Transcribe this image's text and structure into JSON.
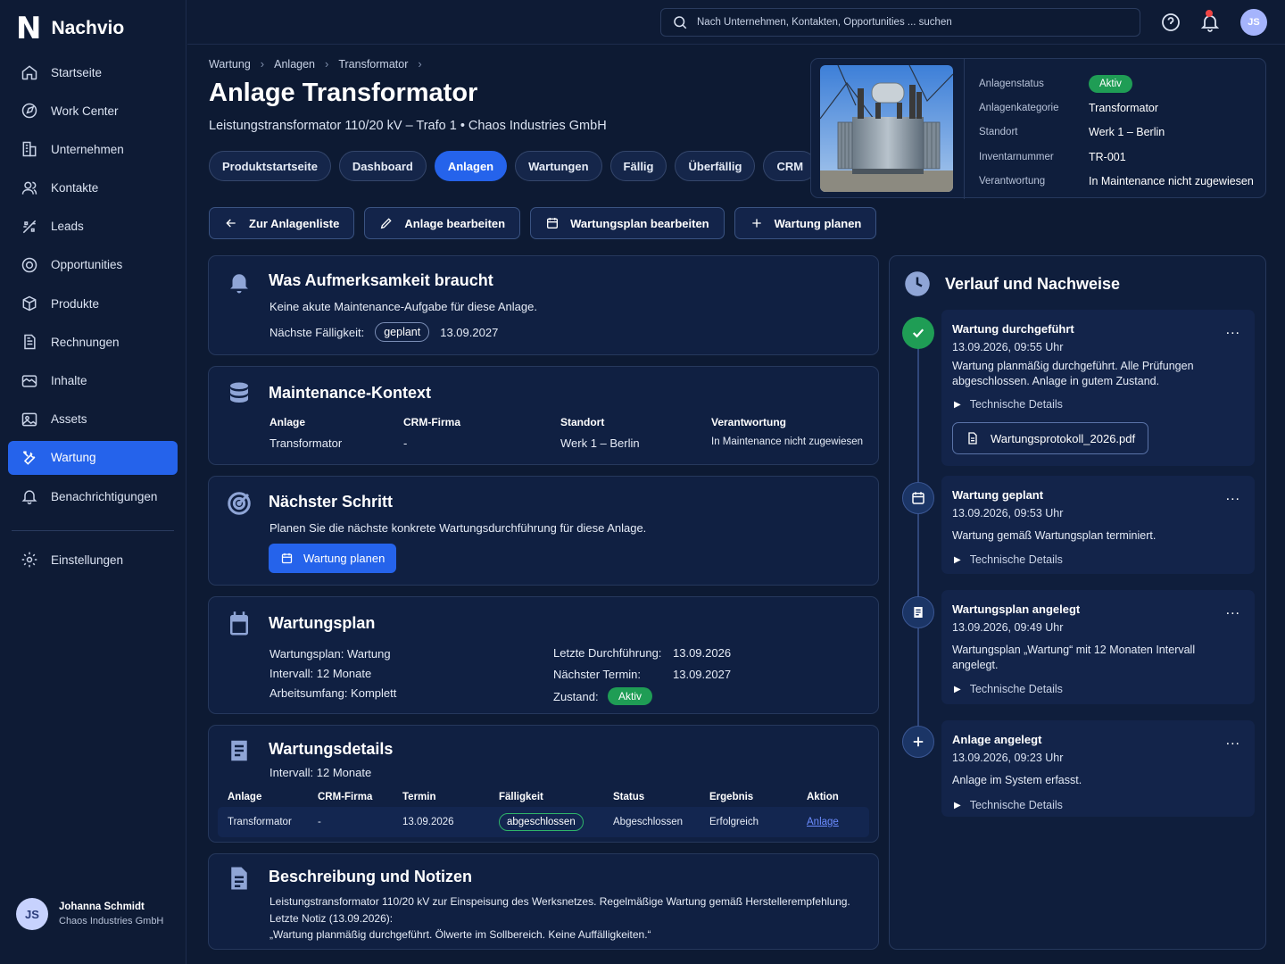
{
  "app": {
    "logo_mark": "N",
    "name": "Nachvio"
  },
  "sidebar": {
    "items": [
      {
        "label": "Startseite",
        "icon": "home-icon"
      },
      {
        "label": "Work Center",
        "icon": "compass-icon"
      },
      {
        "label": "Unternehmen",
        "icon": "building-icon"
      },
      {
        "label": "Kontakte",
        "icon": "users-icon"
      },
      {
        "label": "Leads",
        "icon": "leads-icon"
      },
      {
        "label": "Opportunities",
        "icon": "target-icon"
      },
      {
        "label": "Produkte",
        "icon": "box-icon"
      },
      {
        "label": "Rechnungen",
        "icon": "invoice-icon"
      },
      {
        "label": "Inhalte",
        "icon": "content-icon"
      },
      {
        "label": "Assets",
        "icon": "image-icon"
      },
      {
        "label": "Wartung",
        "icon": "tools-icon",
        "active": true
      },
      {
        "label": "Benachrichtigungen",
        "icon": "bell-icon"
      }
    ],
    "settings_label": "Einstellungen",
    "user": {
      "initials": "JS",
      "name": "Johanna Schmidt",
      "company": "Chaos Industries GmbH"
    }
  },
  "topbar": {
    "search_placeholder": "Nach Unternehmen, Kontakten, Opportunities ... suchen",
    "avatar_initials": "JS"
  },
  "breadcrumb": [
    "Wartung",
    "Anlagen",
    "Transformator"
  ],
  "page": {
    "title": "Anlage Transformator",
    "subtitle": "Leistungstransformator 110/20 kV – Trafo 1  •  Chaos Industries GmbH"
  },
  "tabs": [
    {
      "label": "Produktstartseite"
    },
    {
      "label": "Dashboard"
    },
    {
      "label": "Anlagen",
      "active": true
    },
    {
      "label": "Wartungen"
    },
    {
      "label": "Fällig"
    },
    {
      "label": "Überfällig"
    },
    {
      "label": "CRM"
    }
  ],
  "actions": {
    "back": "Zur Anlagenliste",
    "edit": "Anlage bearbeiten",
    "edit_plan": "Wartungsplan bearbeiten",
    "plan": "Wartung planen"
  },
  "asset": {
    "rows": [
      {
        "label": "Anlagenstatus",
        "value": "Aktiv",
        "badge": true
      },
      {
        "label": "Anlagenkategorie",
        "value": "Transformator"
      },
      {
        "label": "Standort",
        "value": "Werk 1 – Berlin"
      },
      {
        "label": "Inventarnummer",
        "value": "TR-001"
      },
      {
        "label": "Verantwortung",
        "value": "In Maintenance nicht zugewiesen"
      }
    ]
  },
  "attention": {
    "title": "Was Aufmerksamkeit braucht",
    "text": "Keine akute Maintenance-Aufgabe für diese Anlage.",
    "due_label": "Nächste Fälligkeit:",
    "due_tag": "geplant",
    "due_date": "13.09.2027"
  },
  "context": {
    "title": "Maintenance-Kontext",
    "cols": [
      {
        "label": "Anlage",
        "value": "Transformator"
      },
      {
        "label": "CRM-Firma",
        "value": "-"
      },
      {
        "label": "Standort",
        "value": "Werk 1 – Berlin"
      },
      {
        "label": "Verantwortung",
        "value": "In Maintenance nicht zugewiesen"
      }
    ]
  },
  "next_step": {
    "title": "Nächster Schritt",
    "text": "Planen Sie die nächste konkrete Wartungsdurchführung für diese Anlage.",
    "button": "Wartung planen"
  },
  "plan": {
    "title": "Wartungsplan",
    "left": [
      "Wartungsplan: Wartung",
      "Intervall: 12 Monate",
      "Arbeitsumfang: Komplett"
    ],
    "last_label": "Letzte Durchführung:",
    "last_value": "13.09.2026",
    "next_label": "Nächster Termin:",
    "next_value": "13.09.2027",
    "state_label": "Zustand:",
    "state_value": "Aktiv"
  },
  "details": {
    "title": "Wartungsdetails",
    "interval": "Intervall: 12 Monate",
    "headers": [
      "Anlage",
      "CRM-Firma",
      "Termin",
      "Fälligkeit",
      "Status",
      "Ergebnis",
      "Aktion"
    ],
    "row": [
      "Transformator",
      "-",
      "13.09.2026",
      "abgeschlossen",
      "Abgeschlossen",
      "Erfolgreich",
      "Anlage"
    ]
  },
  "notes": {
    "title": "Beschreibung und Notizen",
    "line1": "Leistungstransformator 110/20 kV zur Einspeisung des Werksnetzes. Regelmäßige Wartung gemäß Herstellerempfehlung.",
    "line2": "Letzte Notiz (13.09.2026):",
    "line3": "„Wartung planmäßig durchgeführt. Ölwerte im Sollbereich. Keine Auffälligkeiten.“"
  },
  "history": {
    "title": "Verlauf und Nachweise",
    "more": "...",
    "tech_label": "Technische Details",
    "items": [
      {
        "title": "Wartung durchgeführt",
        "date": "13.09.2026, 09:55 Uhr",
        "text": "Wartung planmäßig durchgeführt. Alle Prüfungen abgeschlossen. Anlage in gutem Zustand.",
        "file": "Wartungsprotokoll_2026.pdf"
      },
      {
        "title": "Wartung geplant",
        "date": "13.09.2026, 09:53 Uhr",
        "text": "Wartung gemäß Wartungsplan terminiert."
      },
      {
        "title": "Wartungsplan angelegt",
        "date": "13.09.2026, 09:49 Uhr",
        "text": "Wartungsplan „Wartung“ mit 12 Monaten Intervall angelegt."
      },
      {
        "title": "Anlage angelegt",
        "date": "13.09.2026, 09:23 Uhr",
        "text": "Anlage im System erfasst."
      }
    ]
  },
  "colors": {
    "accent": "#2563eb",
    "success": "#1f9d55",
    "background": "#0d1a33"
  }
}
